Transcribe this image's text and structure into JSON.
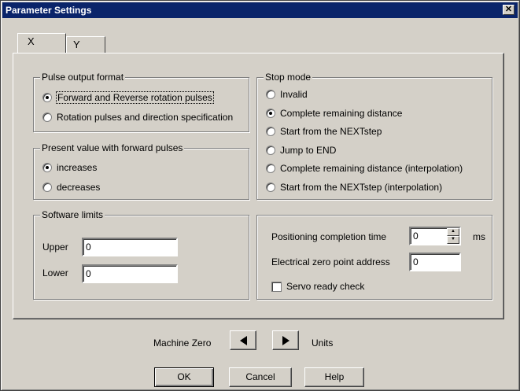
{
  "window": {
    "title": "Parameter Settings",
    "close_glyph": "✕"
  },
  "tabs": [
    {
      "label": "X"
    },
    {
      "label": "Y"
    }
  ],
  "pulse_output": {
    "title": "Pulse output format",
    "options": [
      {
        "label": "Forward and Reverse rotation pulses",
        "selected": true
      },
      {
        "label": "Rotation pulses and direction specification",
        "selected": false
      }
    ]
  },
  "present_value": {
    "title": "Present value with forward pulses",
    "options": [
      {
        "label": "increases",
        "selected": true
      },
      {
        "label": "decreases",
        "selected": false
      }
    ]
  },
  "software_limits": {
    "title": "Software limits",
    "upper_label": "Upper",
    "upper_value": "0",
    "lower_label": "Lower",
    "lower_value": "0"
  },
  "stop_mode": {
    "title": "Stop mode",
    "options": [
      {
        "label": "Invalid",
        "selected": false
      },
      {
        "label": "Complete remaining distance",
        "selected": true
      },
      {
        "label": "Start from the NEXTstep",
        "selected": false
      },
      {
        "label": "Jump to END",
        "selected": false
      },
      {
        "label": "Complete remaining distance (interpolation)",
        "selected": false
      },
      {
        "label": "Start from the NEXTstep (interpolation)",
        "selected": false
      }
    ]
  },
  "positioning": {
    "completion_label": "Positioning completion time",
    "completion_value": "0",
    "completion_unit": "ms",
    "zero_label": "Electrical zero point address",
    "zero_value": "0",
    "servo_label": "Servo ready check",
    "servo_checked": false
  },
  "machine_zero": {
    "label": "Machine Zero",
    "units_label": "Units"
  },
  "buttons": {
    "ok": "OK",
    "cancel": "Cancel",
    "help": "Help"
  }
}
